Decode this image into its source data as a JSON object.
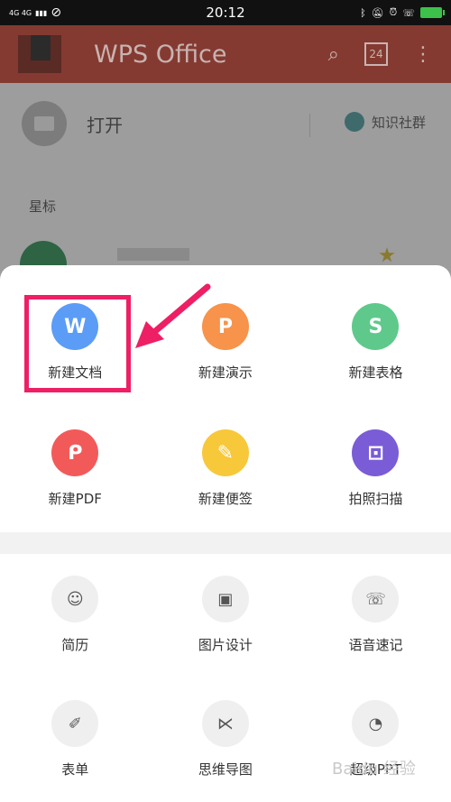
{
  "status_bar": {
    "signal_text": "4G 4G",
    "time": "20:12",
    "right_icons": [
      "bluetooth-icon",
      "bell-muted-icon",
      "alarm-icon",
      "hd-call-icon",
      "battery-icon"
    ]
  },
  "app_bar": {
    "title": "WPS Office",
    "calendar_day": "24"
  },
  "background": {
    "open_label": "打开",
    "community_label": "知识社群",
    "starred_label": "星标"
  },
  "sheet": {
    "create_items": [
      {
        "label": "新建文档",
        "glyph": "W",
        "color": "#5b9cf6",
        "icon": "writer-icon"
      },
      {
        "label": "新建演示",
        "glyph": "P",
        "color": "#f7934a",
        "icon": "presentation-icon"
      },
      {
        "label": "新建表格",
        "glyph": "S",
        "color": "#5ec98b",
        "icon": "spreadsheet-icon"
      },
      {
        "label": "新建PDF",
        "glyph": "ᑭ",
        "color": "#f25a5a",
        "icon": "pdf-icon"
      },
      {
        "label": "新建便签",
        "glyph": "✎",
        "color": "#f7c83a",
        "icon": "note-icon"
      },
      {
        "label": "拍照扫描",
        "glyph": "⊡",
        "color": "#7a5cd6",
        "icon": "scan-icon"
      }
    ],
    "template_items": [
      {
        "label": "简历",
        "glyph": "☺",
        "icon": "resume-icon"
      },
      {
        "label": "图片设计",
        "glyph": "▣",
        "icon": "image-design-icon"
      },
      {
        "label": "语音速记",
        "glyph": "☏",
        "icon": "voice-note-icon"
      },
      {
        "label": "表单",
        "glyph": "✐",
        "icon": "form-icon"
      },
      {
        "label": "思维导图",
        "glyph": "⋉",
        "icon": "mind-map-icon"
      },
      {
        "label": "超级PPT",
        "glyph": "◔",
        "icon": "super-ppt-icon"
      }
    ]
  },
  "watermark": "Baidu 经验"
}
